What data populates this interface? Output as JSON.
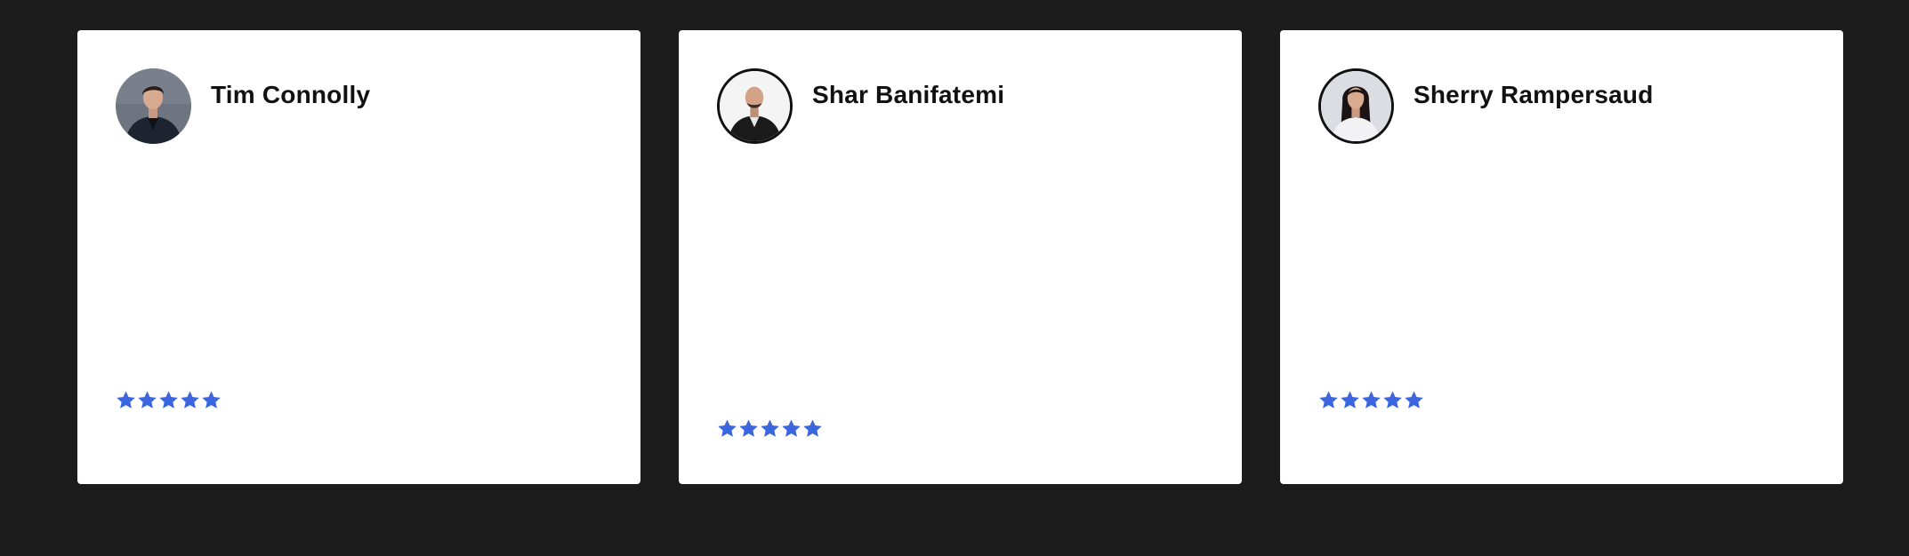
{
  "colors": {
    "page_background": "#1c1c1c",
    "card_background": "#ffffff",
    "star": "#3b66e0",
    "name_text": "#111111"
  },
  "reviews": [
    {
      "name": "Tim Connolly",
      "avatar_icon": "person-photo-avatar",
      "rating": 5,
      "max_rating": 5
    },
    {
      "name": "Shar Banifatemi",
      "avatar_icon": "person-photo-avatar",
      "rating": 5,
      "max_rating": 5
    },
    {
      "name": "Sherry Rampersaud",
      "avatar_icon": "person-photo-avatar",
      "rating": 5,
      "max_rating": 5
    }
  ]
}
